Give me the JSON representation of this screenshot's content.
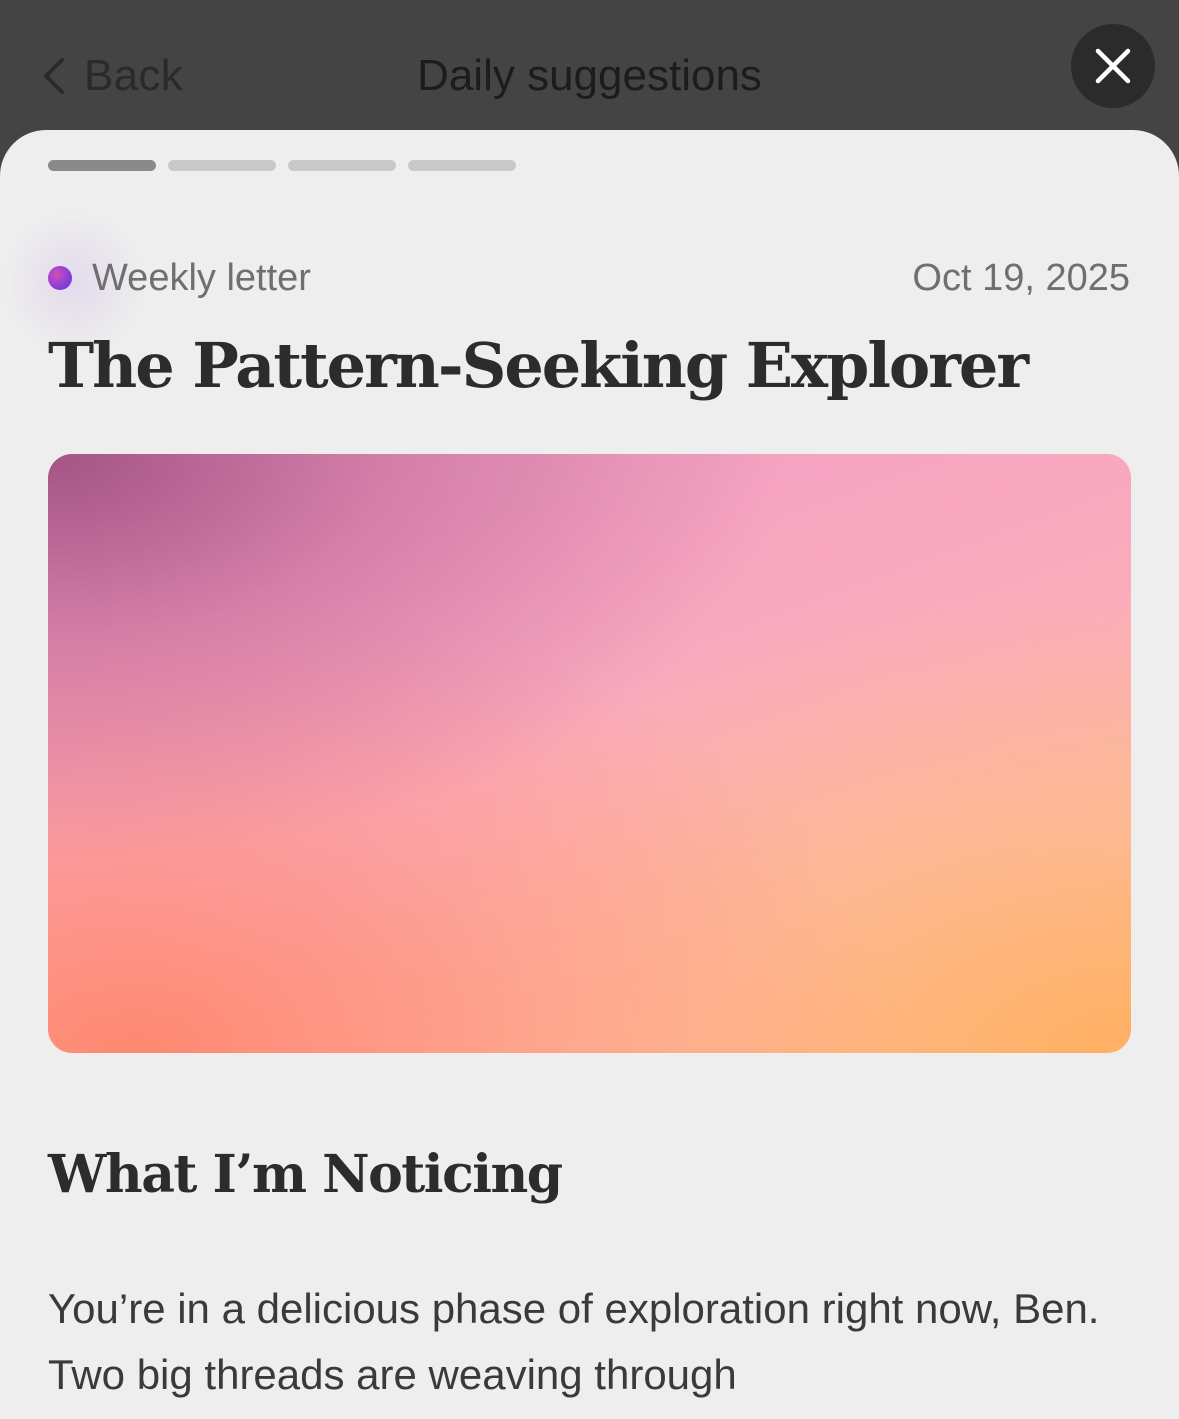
{
  "nav": {
    "back_label": "Back",
    "title": "Daily suggestions",
    "close_icon": "close-icon",
    "back_icon": "chevron-left-icon"
  },
  "progress": {
    "total_segments": 4,
    "active_segment": 1
  },
  "letter": {
    "category": "Weekly letter",
    "date": "Oct 19, 2025",
    "title": "The Pattern-Seeking Explorer",
    "hero_image": "gradient-cover-image",
    "section_heading": "What I’m Noticing",
    "body": "You’re in a delicious phase of exploration right now, Ben. Two big threads are weaving through"
  },
  "colors": {
    "top_bar": "#444444",
    "sheet_background": "#eeeeee",
    "dot_gradient_start": "#d24fb7",
    "dot_gradient_end": "#4d3bd6"
  }
}
